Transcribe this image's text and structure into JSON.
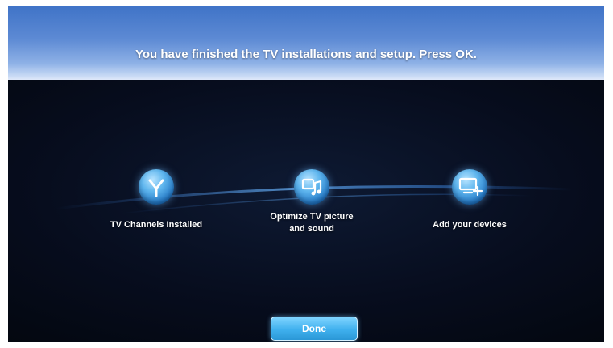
{
  "header": {
    "message": "You have finished the TV installations and setup. Press OK."
  },
  "steps": [
    {
      "icon": "antenna-icon",
      "label_line1": "TV Channels Installed",
      "label_line2": ""
    },
    {
      "icon": "picture-sound-icon",
      "label_line1": "Optimize TV picture",
      "label_line2": "and sound"
    },
    {
      "icon": "add-device-icon",
      "label_line1": "Add your devices",
      "label_line2": ""
    }
  ],
  "actions": {
    "done_label": "Done"
  },
  "colors": {
    "banner": "#5d8ad4",
    "background": "#070d1e",
    "accent": "#3fb0ee"
  }
}
